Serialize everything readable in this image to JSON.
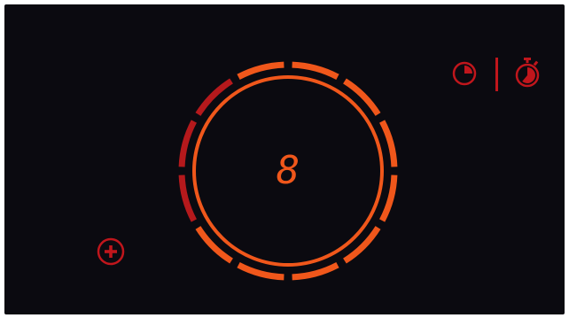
{
  "cooktop": {
    "background_color": "#0b0a10",
    "zone": {
      "power_level_display": "8",
      "ring_color": "#f0571b",
      "digit_color": "#f0571b",
      "segment_total": 12,
      "segments_active_color": "#f0571b",
      "segments_low_color": "#b5191c",
      "segments_low": [
        8,
        9,
        10
      ]
    },
    "timer_controls": {
      "kitchen_timer_icon": "clock-pie-icon",
      "cook_timer_icon": "stopwatch-icon",
      "icon_color": "#c0161c"
    },
    "add_zone_button": {
      "icon": "plus-circle-icon",
      "icon_color": "#c0161c"
    }
  }
}
